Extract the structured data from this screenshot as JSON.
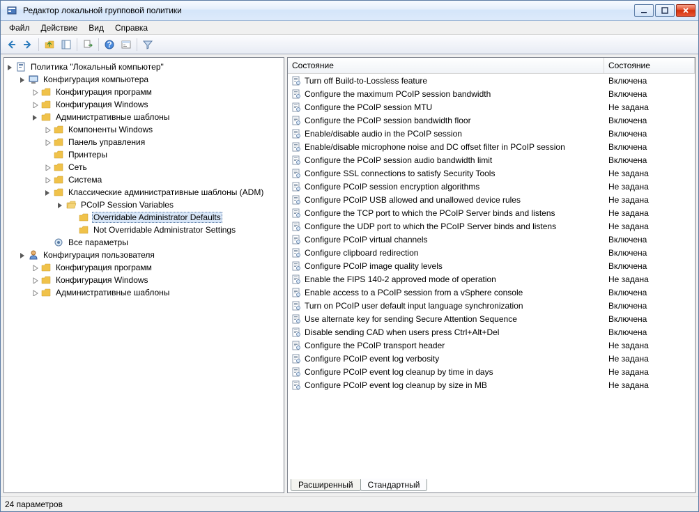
{
  "window": {
    "title": "Редактор локальной групповой политики"
  },
  "menubar": {
    "file": "Файл",
    "action": "Действие",
    "view": "Вид",
    "help": "Справка"
  },
  "tree": {
    "root": "Политика \"Локальный компьютер\"",
    "computer_config": "Конфигурация компьютера",
    "software_settings": "Конфигурация программ",
    "windows_settings": "Конфигурация Windows",
    "admin_templates": "Административные шаблоны",
    "windows_components": "Компоненты Windows",
    "control_panel": "Панель управления",
    "printers": "Принтеры",
    "network": "Сеть",
    "system": "Система",
    "classic_adm": "Классические административные шаблоны (ADM)",
    "pcoip_session_vars": "PCoIP Session Variables",
    "overridable_defaults": "Overridable Administrator Defaults",
    "not_overridable_settings": "Not Overridable Administrator Settings",
    "all_settings": "Все параметры",
    "user_config": "Конфигурация пользователя"
  },
  "list": {
    "col_state": "Состояние",
    "col_state2": "Состояние",
    "items": [
      {
        "name": "Turn off Build-to-Lossless feature",
        "state": "Включена"
      },
      {
        "name": "Configure the maximum PCoIP session bandwidth",
        "state": "Включена"
      },
      {
        "name": "Configure the PCoIP session MTU",
        "state": "Не задана"
      },
      {
        "name": "Configure the PCoIP session bandwidth floor",
        "state": "Включена"
      },
      {
        "name": "Enable/disable audio in the PCoIP session",
        "state": "Включена"
      },
      {
        "name": "Enable/disable microphone noise and DC offset filter in PCoIP session",
        "state": "Включена"
      },
      {
        "name": "Configure the PCoIP session audio bandwidth limit",
        "state": "Включена"
      },
      {
        "name": "Configure SSL connections to satisfy Security Tools",
        "state": "Не задана"
      },
      {
        "name": "Configure PCoIP session encryption algorithms",
        "state": "Не задана"
      },
      {
        "name": "Configure PCoIP USB allowed and unallowed device rules",
        "state": "Не задана"
      },
      {
        "name": "Configure the TCP port to which the PCoIP Server binds and listens",
        "state": "Не задана"
      },
      {
        "name": "Configure the UDP port to which the PCoIP Server binds and listens",
        "state": "Не задана"
      },
      {
        "name": "Configure PCoIP virtual channels",
        "state": "Включена"
      },
      {
        "name": "Configure clipboard redirection",
        "state": "Включена"
      },
      {
        "name": "Configure PCoIP image quality levels",
        "state": "Включена"
      },
      {
        "name": "Enable the FIPS 140-2 approved mode of operation",
        "state": "Не задана"
      },
      {
        "name": "Enable access to a PCoIP session from a vSphere console",
        "state": "Включена"
      },
      {
        "name": "Turn on PCoIP user default input language synchronization",
        "state": "Включена"
      },
      {
        "name": "Use alternate key for sending Secure Attention Sequence",
        "state": "Включена"
      },
      {
        "name": "Disable sending CAD when users press Ctrl+Alt+Del",
        "state": "Включена"
      },
      {
        "name": "Configure the PCoIP transport header",
        "state": "Не задана"
      },
      {
        "name": "Configure PCoIP event log verbosity",
        "state": "Не задана"
      },
      {
        "name": "Configure PCoIP event log cleanup by time in days",
        "state": "Не задана"
      },
      {
        "name": "Configure PCoIP event log cleanup by size in MB",
        "state": "Не задана"
      }
    ]
  },
  "tabs": {
    "extended": "Расширенный",
    "standard": "Стандартный"
  },
  "statusbar": {
    "text": "24 параметров"
  }
}
